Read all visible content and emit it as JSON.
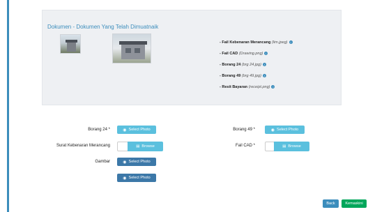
{
  "panel": {
    "title": "Dokumen - Dokumen Yang Telah Dimuatnaik",
    "files": [
      {
        "label": "- Fail Kebenaran Merancang",
        "hint": "(lim.jpeg)"
      },
      {
        "label": "- Fail CAD",
        "hint": "(Drawing.png)"
      },
      {
        "label": "- Borang 24",
        "hint": "(brg 24.jpg)"
      },
      {
        "label": "- Borang 49",
        "hint": "(brg 49.jpg)"
      },
      {
        "label": "- Resit Bayaran",
        "hint": "(receipt.png)"
      }
    ],
    "info_icon": "info-circle-icon"
  },
  "form": {
    "borang24_label": "Borang 24 *",
    "borang49_label": "Borang 49 *",
    "surat_label": "Surat Kebenaran Merancang",
    "failcad_label": "Fail CAD *",
    "gambar_label": "Gambar",
    "select_photo": "Select Photo",
    "browse": "Browse"
  },
  "footer": {
    "back": "Back",
    "save": "Kemaskini"
  },
  "colors": {
    "accent": "#3c8dbc",
    "info": "#5bc0de",
    "success": "#00a65a"
  }
}
